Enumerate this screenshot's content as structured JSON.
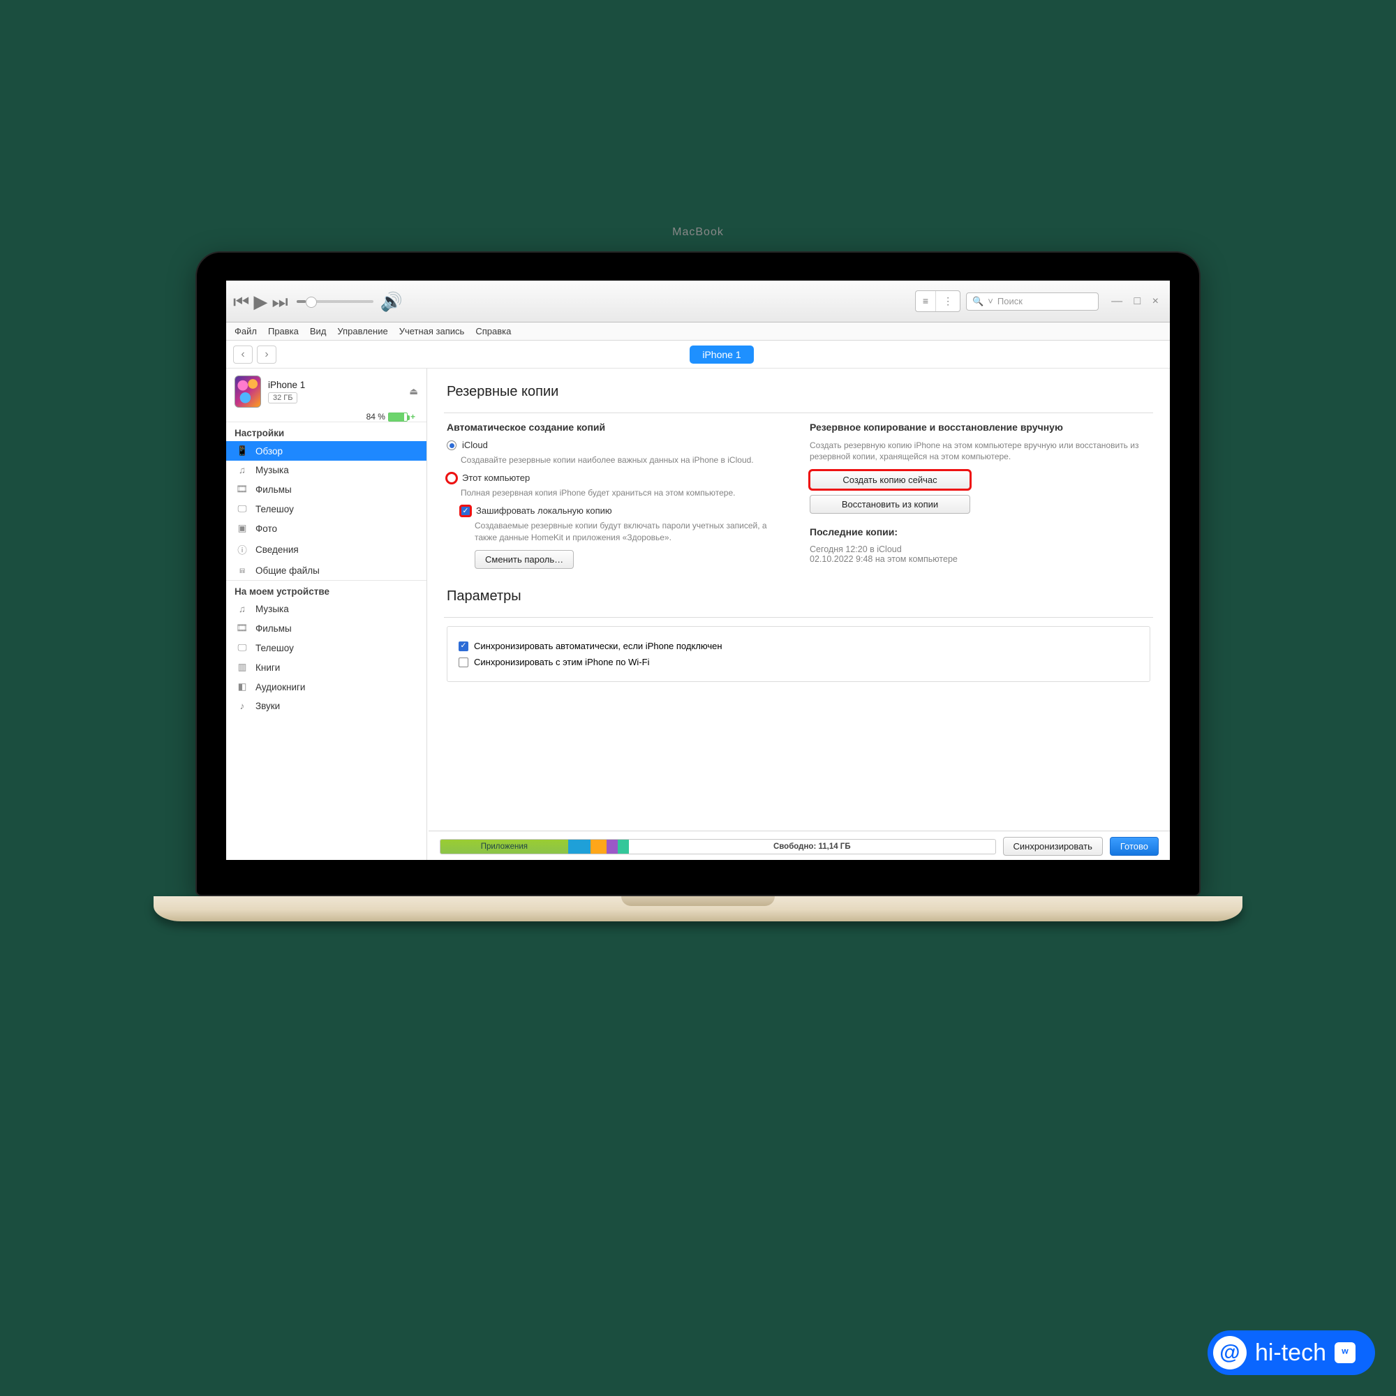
{
  "toolbar": {
    "search_placeholder": "Поиск"
  },
  "menubar": [
    "Файл",
    "Правка",
    "Вид",
    "Управление",
    "Учетная запись",
    "Справка"
  ],
  "nav_pill": "iPhone 1",
  "device": {
    "name": "iPhone 1",
    "capacity": "32 ГБ",
    "battery_pct": "84 %"
  },
  "sidebar": {
    "settings_heading": "Настройки",
    "settings_items": [
      {
        "icon": "📱",
        "label": "Обзор",
        "active": true
      },
      {
        "icon": "♫",
        "label": "Музыка"
      },
      {
        "icon": "🎞",
        "label": "Фильмы"
      },
      {
        "icon": "🖵",
        "label": "Телешоу"
      },
      {
        "icon": "▣",
        "label": "Фото"
      },
      {
        "icon": "ⓘ",
        "label": "Сведения"
      },
      {
        "icon": "⩎",
        "label": "Общие файлы"
      }
    ],
    "device_heading": "На моем устройстве",
    "device_items": [
      {
        "icon": "♫",
        "label": "Музыка"
      },
      {
        "icon": "🎞",
        "label": "Фильмы"
      },
      {
        "icon": "🖵",
        "label": "Телешоу"
      },
      {
        "icon": "▥",
        "label": "Книги"
      },
      {
        "icon": "◧",
        "label": "Аудиокниги"
      },
      {
        "icon": "♪",
        "label": "Звуки"
      }
    ]
  },
  "backup": {
    "section_title": "Резервные копии",
    "auto_heading": "Автоматическое создание копий",
    "icloud_label": "iCloud",
    "icloud_desc": "Создавайте резервные копии наиболее важных данных на iPhone в iCloud.",
    "this_pc_label": "Этот компьютер",
    "this_pc_desc": "Полная резервная копия iPhone будет храниться на этом компьютере.",
    "encrypt_label": "Зашифровать локальную копию",
    "encrypt_desc": "Создаваемые резервные копии будут включать пароли учетных записей, а также данные HomeKit и приложения «Здоровье».",
    "change_pw_btn": "Сменить пароль…",
    "manual_heading": "Резервное копирование и восстановление вручную",
    "manual_desc": "Создать резервную копию iPhone на этом компьютере вручную или восстановить из резервной копии, хранящейся на этом компьютере.",
    "backup_now_btn": "Создать копию сейчас",
    "restore_btn": "Восстановить из копии",
    "last_heading": "Последние копии:",
    "last_line1": "Сегодня 12:20 в iCloud",
    "last_line2": "02.10.2022 9:48 на этом компьютере"
  },
  "options": {
    "section_title": "Параметры",
    "auto_sync": "Синхронизировать автоматически, если iPhone подключен",
    "wifi_sync": "Синхронизировать с этим iPhone по Wi-Fi"
  },
  "bottom": {
    "apps_label": "Приложения",
    "free_label": "Свободно: 11,14 ГБ",
    "sync_btn": "Синхронизировать",
    "done_btn": "Готово"
  },
  "base_label": "MacBook",
  "watermark": {
    "text": "hi-tech",
    "vk": "ʷ"
  }
}
